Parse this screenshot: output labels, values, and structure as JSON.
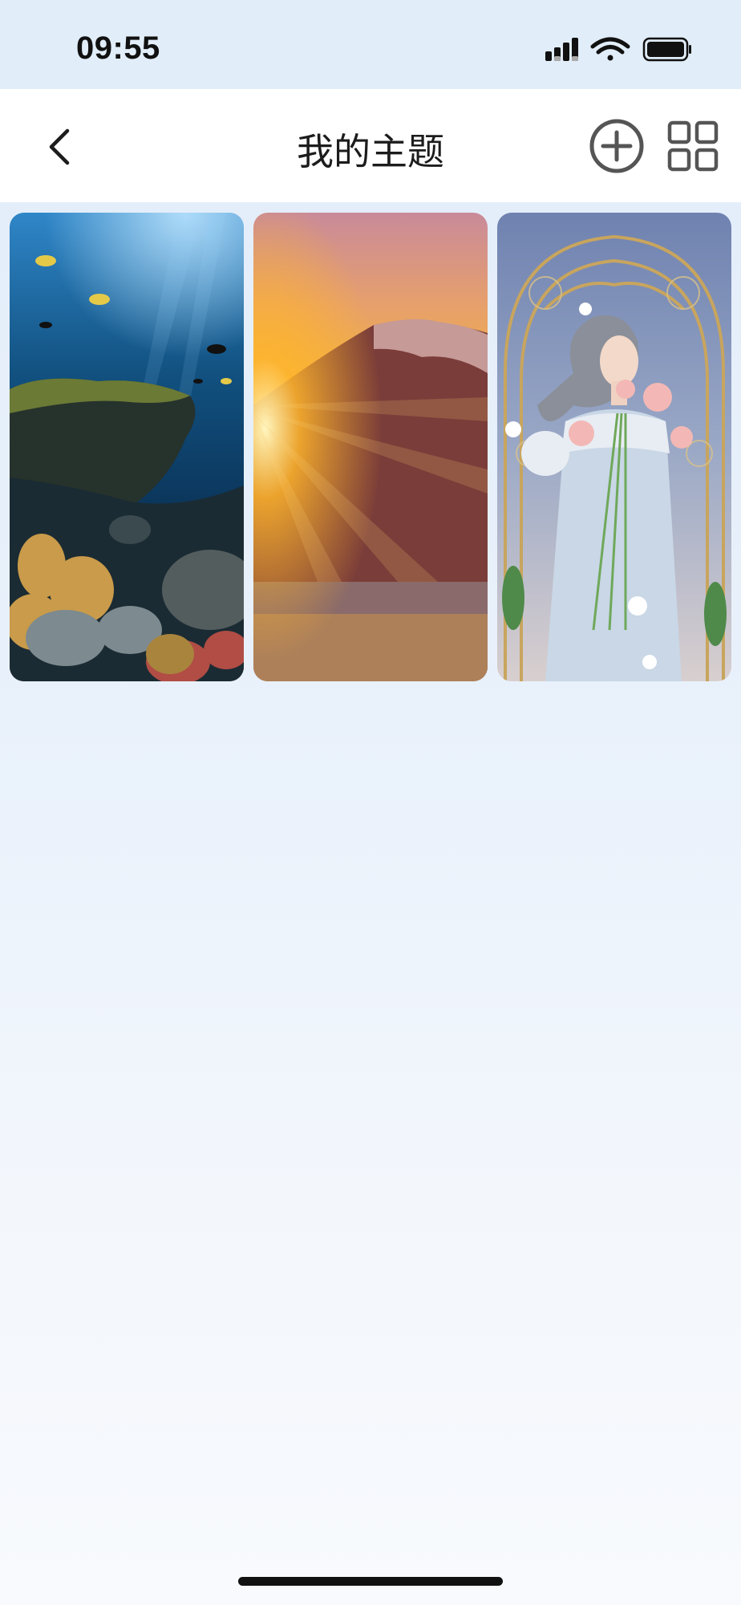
{
  "status_bar": {
    "time": "09:55",
    "icons": [
      "cellular-signal-icon",
      "wifi-icon",
      "battery-icon"
    ]
  },
  "nav": {
    "title": "我的主题",
    "back_icon": "chevron-left-icon",
    "add_icon": "plus-circle-icon",
    "grid_icon": "grid-icon"
  },
  "themes": [
    {
      "name": "underwater-coral-reef"
    },
    {
      "name": "mountain-sunset"
    },
    {
      "name": "girl-with-flowers"
    }
  ],
  "colors": {
    "status_bg": "#e1edf8",
    "nav_bg": "#ffffff",
    "icon_gray": "#555555"
  }
}
